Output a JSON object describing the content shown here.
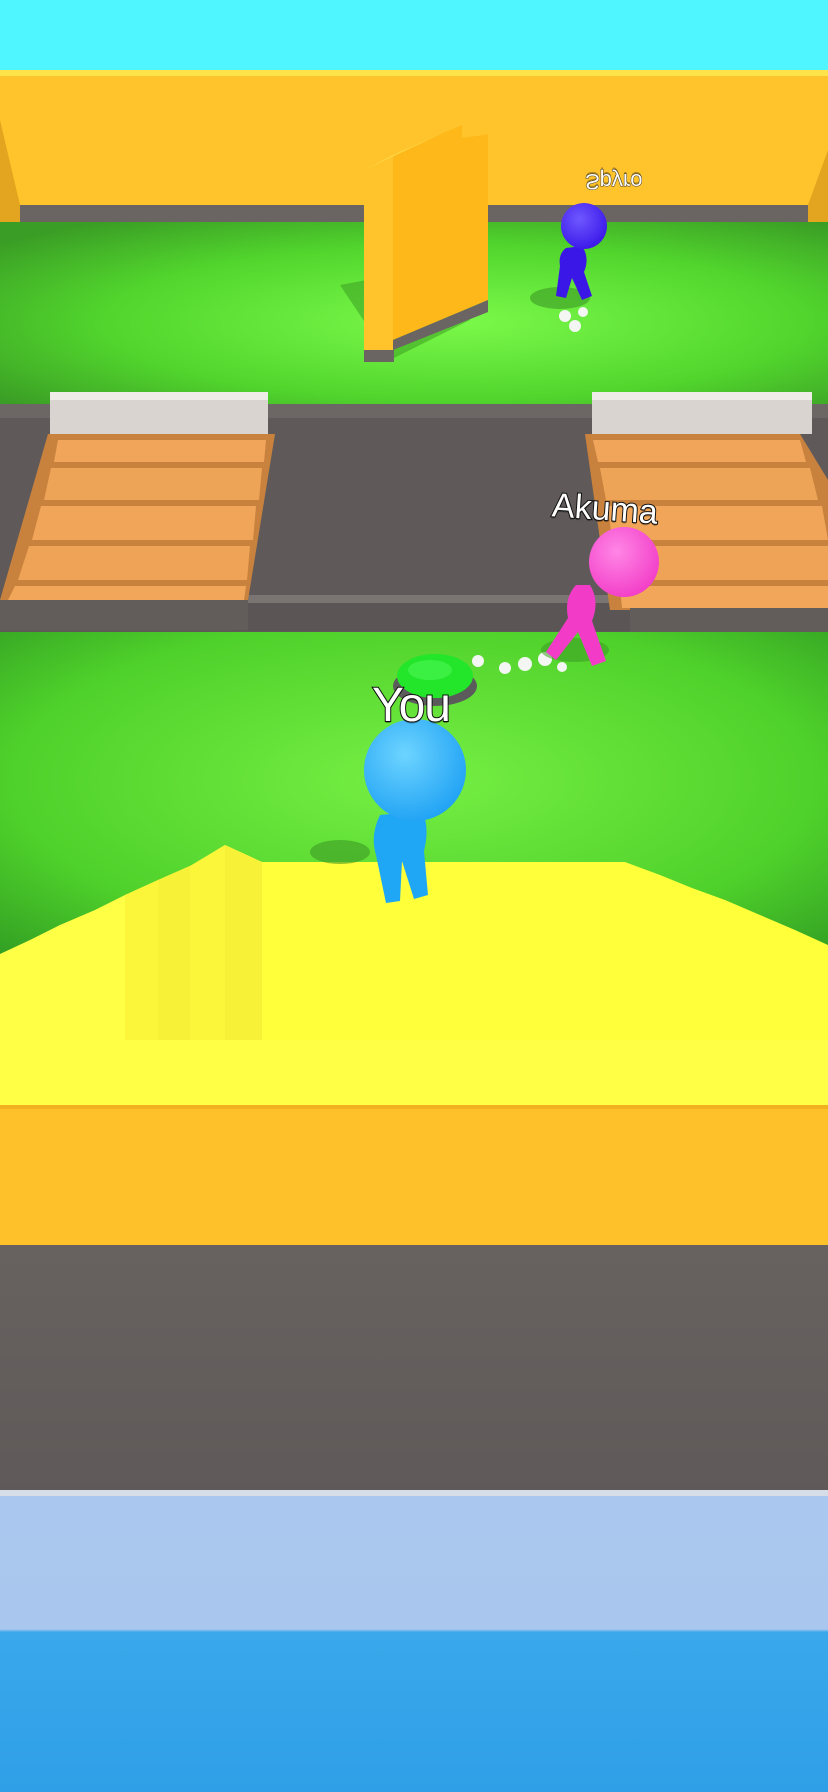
{
  "players": {
    "you": {
      "name": "You",
      "color": "#31b8ff"
    },
    "akuma": {
      "name": "Akuma",
      "color": "#ff4fd2"
    },
    "spyro": {
      "name": "Spyro",
      "color": "#4a2bff"
    }
  },
  "colors": {
    "sky": "#4ff5ff",
    "wall_orange": "#ffc32a",
    "grass": "#4fdc2e",
    "floor_gray": "#686361",
    "stairs_yellow": "#ffff3c",
    "bridge_wood": "#f3a55a",
    "start_button": "#22e62a",
    "water": "#35a6ea"
  },
  "icons": [
    "player-you-icon",
    "player-akuma-icon",
    "player-spyro-icon",
    "green-pressure-button-icon"
  ]
}
